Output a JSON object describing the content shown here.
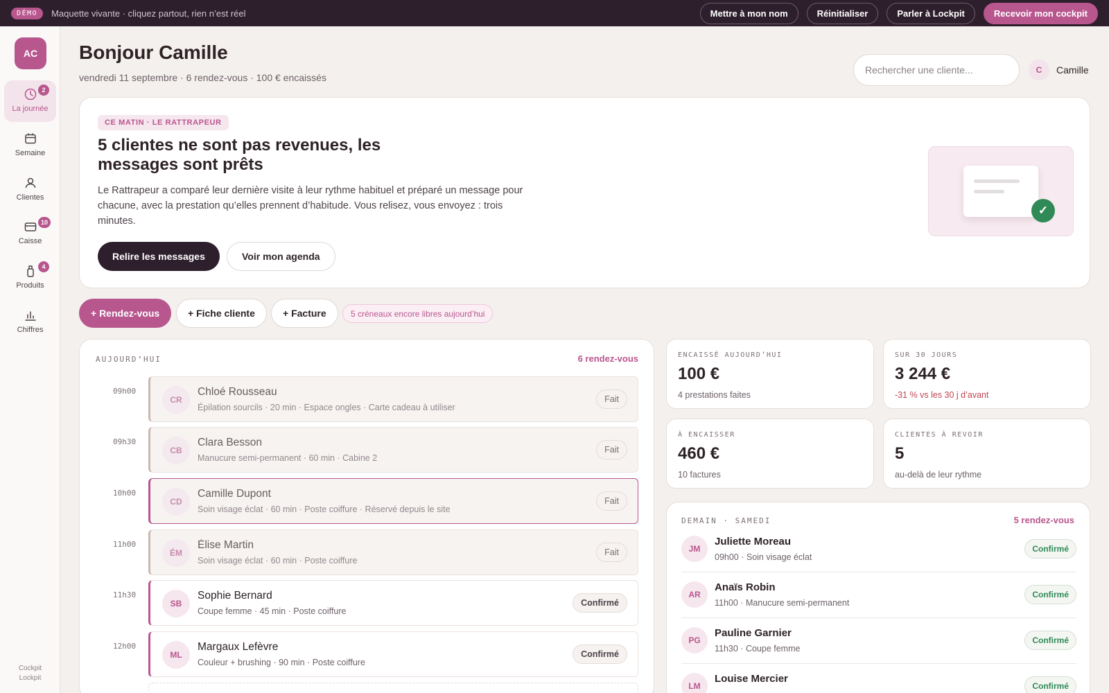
{
  "demo_bar": {
    "badge": "DÉMO",
    "text": "Maquette vivante · cliquez partout, rien n’est réel",
    "actions": [
      "Mettre à mon nom",
      "Réinitialiser",
      "Parler à Lockpit",
      "Recevoir mon cockpit"
    ]
  },
  "sidebar": {
    "logo": "AC",
    "items": [
      {
        "label": "La journée",
        "icon": "clock-icon",
        "badge": "2",
        "active": true
      },
      {
        "label": "Semaine",
        "icon": "calendar-icon",
        "badge": ""
      },
      {
        "label": "Clientes",
        "icon": "user-icon",
        "badge": ""
      },
      {
        "label": "Caisse",
        "icon": "register-icon",
        "badge": "10"
      },
      {
        "label": "Produits",
        "icon": "bottle-icon",
        "badge": "4"
      },
      {
        "label": "Chiffres",
        "icon": "bar-chart-icon",
        "badge": ""
      }
    ],
    "footer_1": "Cockpit",
    "footer_2": "Lockpit"
  },
  "header": {
    "greeting": "Bonjour Camille",
    "subline": "vendredi 11 septembre · 6 rendez-vous · 100 € encaissés",
    "search_placeholder": "Rechercher une cliente...",
    "user_initial": "C",
    "user_name": "Camille"
  },
  "hero": {
    "eyebrow": "CE MATIN · LE RATTRAPEUR",
    "title": "5 clientes ne sont pas revenues, les messages sont prêts",
    "body": "Le Rattrapeur a comparé leur dernière visite à leur rythme habituel et préparé un message pour chacune, avec la prestation qu’elles prennent d’habitude. Vous relisez, vous envoyez : trois minutes.",
    "primary_button": "Relire les messages",
    "secondary_button": "Voir mon agenda"
  },
  "quick_actions": {
    "new_appointment": "+ Rendez-vous",
    "new_client": "+ Fiche cliente",
    "new_invoice": "+ Facture",
    "free_slots": "5 créneaux encore libres aujourd’hui"
  },
  "today": {
    "heading": "AUJOURD’HUI",
    "count": "6 rendez-vous",
    "appointments": [
      {
        "time": "09h00",
        "initials": "CR",
        "name": "Chloé Rousseau",
        "detail": "Épilation sourcils · 20 min · Espace ongles · Carte cadeau à utiliser",
        "status": "Fait"
      },
      {
        "time": "09h30",
        "initials": "CB",
        "name": "Clara Besson",
        "detail": "Manucure semi-permanent · 60 min · Cabine 2",
        "status": "Fait"
      },
      {
        "time": "10h00",
        "initials": "CD",
        "name": "Camille Dupont",
        "detail": "Soin visage éclat · 60 min · Poste coiffure · Réservé depuis le site",
        "status": "Fait"
      },
      {
        "time": "11h00",
        "initials": "ÉM",
        "name": "Élise Martin",
        "detail": "Soin visage éclat · 60 min · Poste coiffure",
        "status": "Fait"
      },
      {
        "time": "11h30",
        "initials": "SB",
        "name": "Sophie Bernard",
        "detail": "Coupe femme · 45 min · Poste coiffure",
        "status": "Confirmé"
      },
      {
        "time": "12h00",
        "initials": "ML",
        "name": "Margaux Lefèvre",
        "detail": "Couleur + brushing · 90 min · Poste coiffure",
        "status": "Confirmé"
      }
    ]
  },
  "kpis": [
    {
      "label": "ENCAISSÉ AUJOURD’HUI",
      "value": "100 €",
      "sub": "4 prestations faites"
    },
    {
      "label": "SUR 30 JOURS",
      "value": "3 244 €",
      "sub": "-31 % vs les 30 j d’avant"
    },
    {
      "label": "À ENCAISSER",
      "value": "460 €",
      "sub": "10 factures"
    },
    {
      "label": "CLIENTES À REVOIR",
      "value": "5",
      "sub": "au-delà de leur rythme"
    }
  ],
  "tomorrow": {
    "heading": "DEMAIN · SAMEDI",
    "count": "5 rendez-vous",
    "appointments": [
      {
        "initials": "JM",
        "name": "Juliette Moreau",
        "detail": "09h00 · Soin visage éclat",
        "status": "Confirmé"
      },
      {
        "initials": "AR",
        "name": "Anaïs Robin",
        "detail": "11h00 · Manucure semi-permanent",
        "status": "Confirmé"
      },
      {
        "initials": "PG",
        "name": "Pauline Garnier",
        "detail": "11h30 · Coupe femme",
        "status": "Confirmé"
      },
      {
        "initials": "LM",
        "name": "Louise Mercier",
        "detail": "",
        "status": "Confirmé"
      }
    ]
  },
  "colors": {
    "accent": "#b8568e",
    "dark": "#2e1f2c",
    "background": "#f4f0ed",
    "success": "#2f8a57",
    "negative": "#c0434f"
  }
}
